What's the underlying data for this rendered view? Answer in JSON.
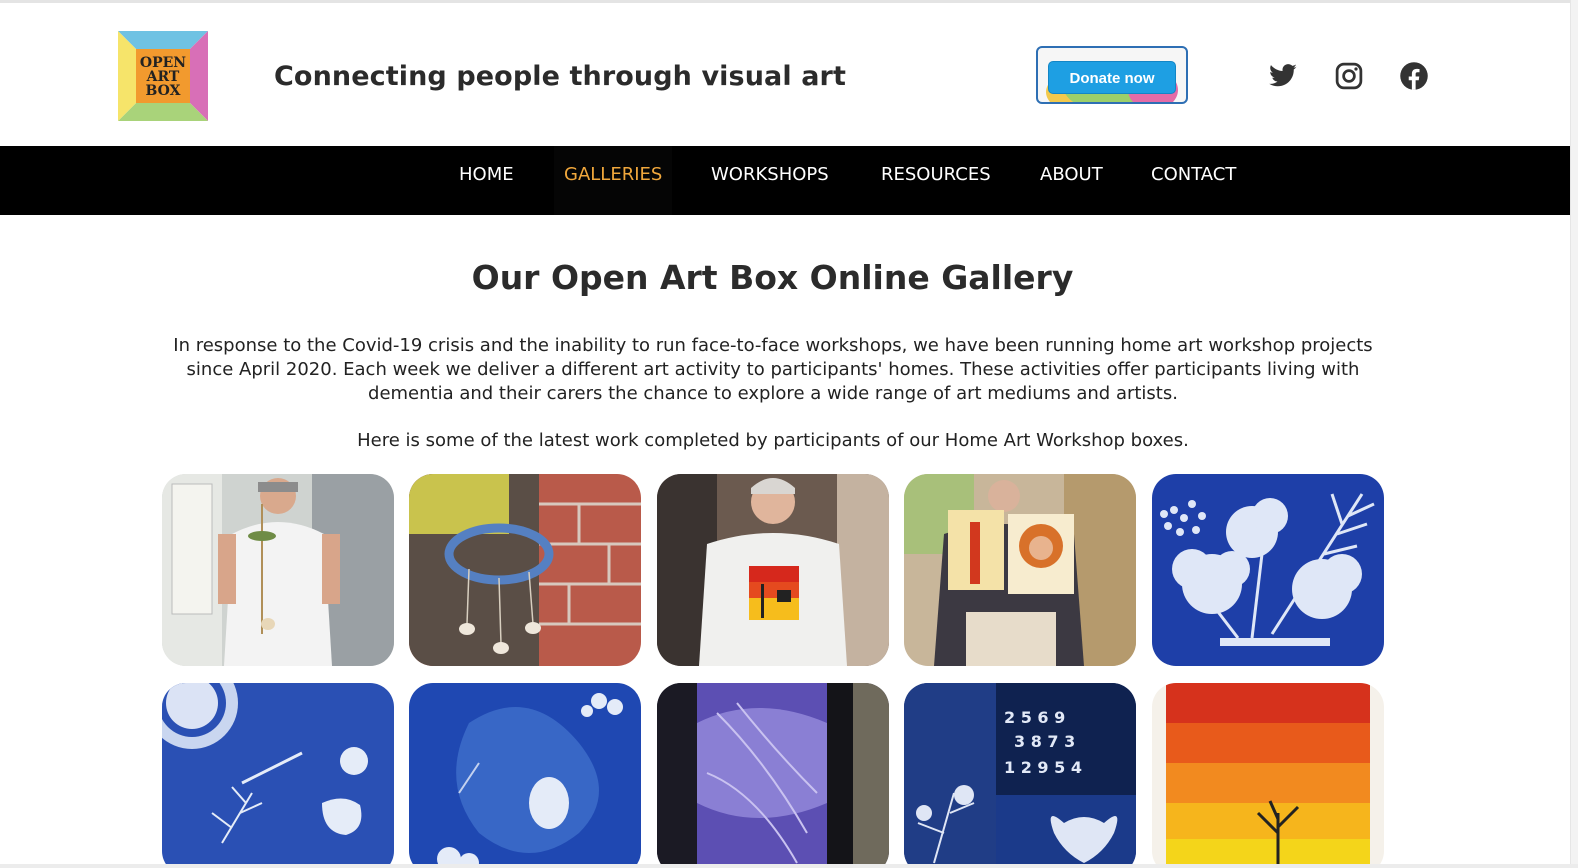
{
  "header": {
    "logo": {
      "lines": [
        "OPEN",
        "ART",
        "BOX"
      ]
    },
    "tagline": "Connecting people through visual art",
    "donate_label": "Donate now",
    "social_icons": [
      "twitter-icon",
      "instagram-icon",
      "facebook-icon"
    ]
  },
  "nav": {
    "items": [
      {
        "label": "HOME",
        "active": false
      },
      {
        "label": "GALLERIES",
        "active": true
      },
      {
        "label": "WORKSHOPS",
        "active": false
      },
      {
        "label": "RESOURCES",
        "active": false
      },
      {
        "label": "ABOUT",
        "active": false
      },
      {
        "label": "CONTACT",
        "active": false
      }
    ]
  },
  "main": {
    "title": "Our Open Art Box Online Gallery",
    "intro": "In response to the Covid-19 crisis and the inability to run face-to-face workshops, we have been running home art workshop projects since April 2020. Each week we deliver a different art activity to participants' homes. These activities offer participants living with dementia and their carers the chance to explore a wide range of art mediums and artists.",
    "latest": "Here is some of the latest work completed by participants of our Home Art Workshop boxes."
  },
  "colors": {
    "nav_bg": "#000000",
    "nav_active": "#f0a73c",
    "donate_button": "#1e9fe3",
    "cyanotype_blue": "#1e3fa8"
  }
}
